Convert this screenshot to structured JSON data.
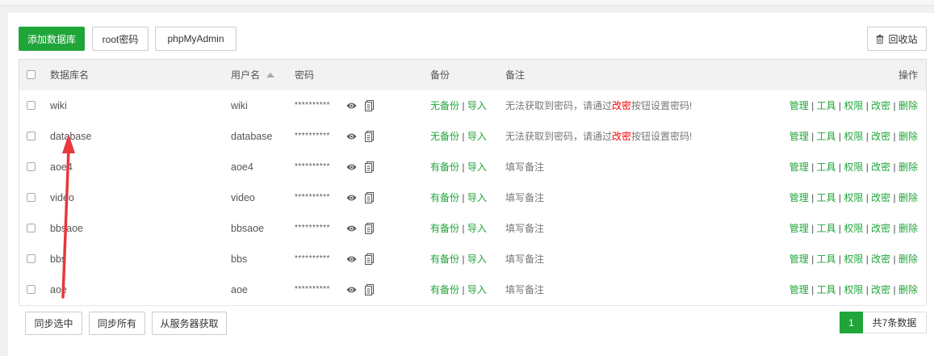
{
  "toolbar": {
    "add_db": "添加数据库",
    "root_pwd": "root密码",
    "phpmyadmin": "phpMyAdmin",
    "recycle": "回收站"
  },
  "table": {
    "headers": {
      "name": "数据库名",
      "user": "用户名",
      "password": "密码",
      "backup": "备份",
      "note": "备注",
      "ops": "操作"
    },
    "rows": [
      {
        "name": "wiki",
        "user": "wiki",
        "password": "**********",
        "backup_status": "无备份",
        "import": "导入",
        "note_pre": "无法获取到密码，请通过",
        "note_link": "改密",
        "note_post": "按钮设置密码!",
        "ops": [
          "管理",
          "工具",
          "权限",
          "改密",
          "删除"
        ]
      },
      {
        "name": "database",
        "user": "database",
        "password": "**********",
        "backup_status": "无备份",
        "import": "导入",
        "note_pre": "无法获取到密码，请通过",
        "note_link": "改密",
        "note_post": "按钮设置密码!",
        "ops": [
          "管理",
          "工具",
          "权限",
          "改密",
          "删除"
        ]
      },
      {
        "name": "aoe4",
        "user": "aoe4",
        "password": "**********",
        "backup_status": "有备份",
        "import": "导入",
        "note_pre": "填写备注",
        "note_link": "",
        "note_post": "",
        "ops": [
          "管理",
          "工具",
          "权限",
          "改密",
          "删除"
        ]
      },
      {
        "name": "video",
        "user": "video",
        "password": "**********",
        "backup_status": "有备份",
        "import": "导入",
        "note_pre": "填写备注",
        "note_link": "",
        "note_post": "",
        "ops": [
          "管理",
          "工具",
          "权限",
          "改密",
          "删除"
        ]
      },
      {
        "name": "bbsaoe",
        "user": "bbsaoe",
        "password": "**********",
        "backup_status": "有备份",
        "import": "导入",
        "note_pre": "填写备注",
        "note_link": "",
        "note_post": "",
        "ops": [
          "管理",
          "工具",
          "权限",
          "改密",
          "删除"
        ]
      },
      {
        "name": "bbs",
        "user": "bbs",
        "password": "**********",
        "backup_status": "有备份",
        "import": "导入",
        "note_pre": "填写备注",
        "note_link": "",
        "note_post": "",
        "ops": [
          "管理",
          "工具",
          "权限",
          "改密",
          "删除"
        ]
      },
      {
        "name": "aoe",
        "user": "aoe",
        "password": "**********",
        "backup_status": "有备份",
        "import": "导入",
        "note_pre": "填写备注",
        "note_link": "",
        "note_post": "",
        "ops": [
          "管理",
          "工具",
          "权限",
          "改密",
          "删除"
        ]
      }
    ]
  },
  "footer": {
    "sync_selected": "同步选中",
    "sync_all": "同步所有",
    "fetch_server": "从服务器获取",
    "page": "1",
    "total": "共7条数据"
  },
  "icons": {
    "eye": "eye-icon",
    "copy": "copy-icon",
    "trash": "trash-icon",
    "sort": "sort-asc-icon"
  },
  "colors": {
    "accent": "#20a53a",
    "warning_link": "#ff0000",
    "annotation_arrow": "#e8383d"
  }
}
